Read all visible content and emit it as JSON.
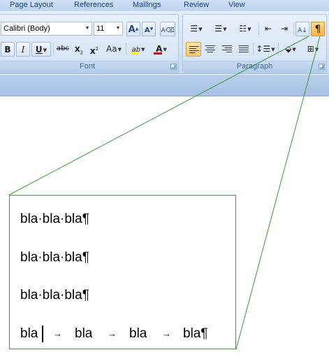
{
  "tabs": [
    "Page Layout",
    "References",
    "Mailings",
    "Review",
    "View"
  ],
  "font": {
    "name": "Calibri (Body)",
    "size": "11",
    "caption": "Font",
    "grow_label": "A",
    "shrink_label": "A",
    "bold_label": "B",
    "italic_label": "I",
    "underline_label": "U",
    "strike_label": "abc",
    "subscript_label": "x",
    "subscript_mark": "2",
    "superscript_label": "x",
    "superscript_mark": "2",
    "case_label": "Aa",
    "highlight_label": "ab",
    "font_color_label": "A"
  },
  "paragraph": {
    "caption": "Paragraph",
    "pilcrow": "¶"
  },
  "document": {
    "lines": [
      "bla·bla·bla¶",
      "bla·bla·bla¶",
      "bla·bla·bla¶"
    ],
    "tab_line": {
      "words": [
        "bla",
        "bla",
        "bla",
        "bla¶"
      ],
      "tab_arrow": "→"
    }
  },
  "colors": {
    "callout": "#3e9a3e",
    "highlight": "#ffff00",
    "font_color": "#e00000",
    "active_button": "#ffc96b"
  }
}
